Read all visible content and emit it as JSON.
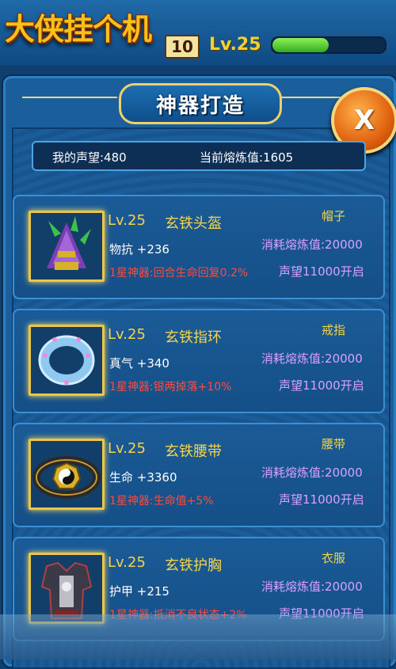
{
  "header": {
    "logo_text": "大侠挂个机",
    "logo_badge": "10",
    "level": "Lv.25"
  },
  "panel": {
    "title": "神器打造",
    "close_label": "X",
    "reputation": "我的声望:480",
    "smelt_value": "当前熔炼值:1605"
  },
  "items": [
    {
      "level": "Lv.25",
      "name": "玄铁头盔",
      "slot": "帽子",
      "attr": "物抗 +236",
      "bonus": "1星神器:回合生命回复0.2%",
      "cost": "消耗熔炼值:20000",
      "unlock": "声望11000开启",
      "icon": "helmet-icon"
    },
    {
      "level": "Lv.25",
      "name": "玄铁指环",
      "slot": "戒指",
      "attr": "真气 +340",
      "bonus": "1星神器:银两掉落+10%",
      "cost": "消耗熔炼值:20000",
      "unlock": "声望11000开启",
      "icon": "ring-icon"
    },
    {
      "level": "Lv.25",
      "name": "玄铁腰带",
      "slot": "腰带",
      "attr": "生命 +3360",
      "bonus": "1星神器:生命值+5%",
      "cost": "消耗熔炼值:20000",
      "unlock": "声望11000开启",
      "icon": "belt-icon"
    },
    {
      "level": "Lv.25",
      "name": "玄铁护胸",
      "slot": "衣服",
      "attr": "护甲 +215",
      "bonus": "1星神器:抵消不良状态+2%",
      "cost": "消耗熔炼值:20000",
      "unlock": "声望11000开启",
      "icon": "armor-icon"
    }
  ]
}
